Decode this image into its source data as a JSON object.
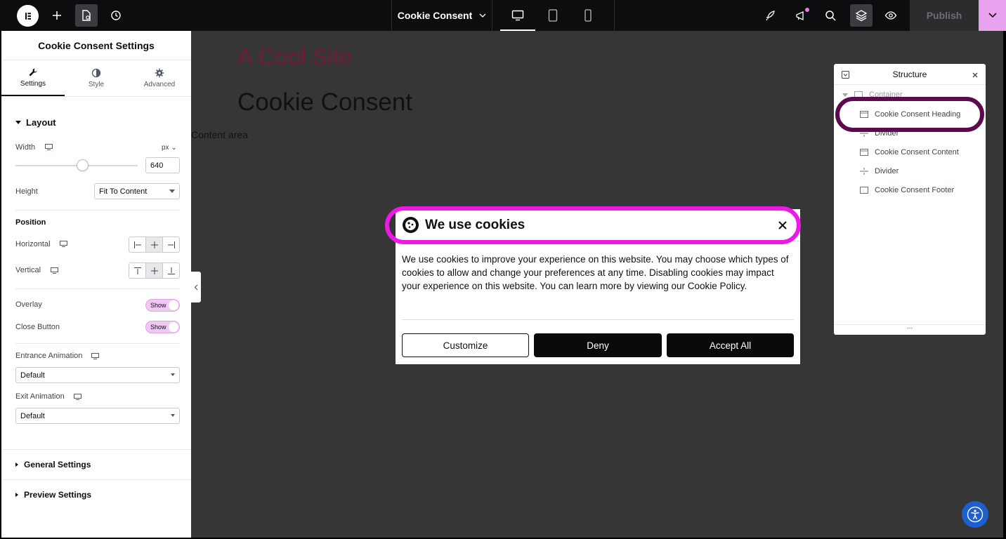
{
  "topbar": {
    "document_title": "Cookie Consent",
    "publish_label": "Publish"
  },
  "panel": {
    "title": "Cookie Consent Settings",
    "tabs": [
      {
        "label": "Settings"
      },
      {
        "label": "Style"
      },
      {
        "label": "Advanced"
      }
    ],
    "layout": {
      "section_label": "Layout",
      "width_label": "Width",
      "width_unit": "px",
      "width_value": "640",
      "width_slider_fraction": 0.55,
      "height_label": "Height",
      "height_value": "Fit To Content",
      "position_label": "Position",
      "horizontal_label": "Horizontal",
      "vertical_label": "Vertical",
      "overlay_label": "Overlay",
      "overlay_value": "Show",
      "close_button_label": "Close Button",
      "close_button_value": "Show",
      "entrance_label": "Entrance Animation",
      "entrance_value": "Default",
      "exit_label": "Exit Animation",
      "exit_value": "Default"
    },
    "general_settings_label": "General Settings",
    "preview_settings_label": "Preview Settings"
  },
  "canvas": {
    "site_title": "A Cool Site",
    "page_heading": "Cookie Consent",
    "content_area": "Content area"
  },
  "popup": {
    "title": "We use cookies",
    "body": "We use cookies to improve your experience on this website. You may choose which types of cookies to allow and change your preferences at any time. Disabling cookies may impact your experience on this website. You can learn more by viewing our Cookie Policy.",
    "buttons": {
      "customize": "Customize",
      "deny": "Deny",
      "accept": "Accept All"
    }
  },
  "structure": {
    "title": "Structure",
    "root": "Container",
    "items": [
      {
        "label": "Cookie Consent Heading"
      },
      {
        "label": "Divider"
      },
      {
        "label": "Cookie Consent Content"
      },
      {
        "label": "Divider"
      },
      {
        "label": "Cookie Consent Footer"
      }
    ],
    "footer": "..."
  },
  "colors": {
    "highlight_popup": "#ee19e6",
    "highlight_structure": "#5c0a4d",
    "accent": "#e9a3ee"
  }
}
